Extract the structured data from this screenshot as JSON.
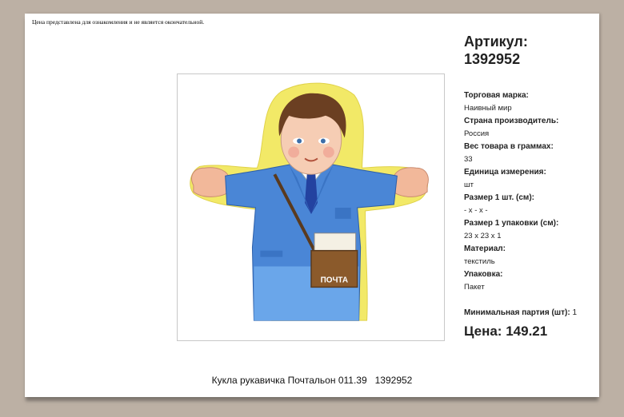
{
  "disclaimer": "Цена представлена для ознакомления и не является окончательной.",
  "article": {
    "label": "Артикул:",
    "number": "1392952"
  },
  "properties": [
    {
      "label": "Торговая марка:",
      "value": "Наивный мир"
    },
    {
      "label": "Страна производитель:",
      "value": "Россия"
    },
    {
      "label": "Вес товара в граммах:",
      "value": "33"
    },
    {
      "label": "Единица измерения:",
      "value": "шт"
    },
    {
      "label": "Размер 1 шт. (см):",
      "value": "- х - х -"
    },
    {
      "label": "Размер 1 упаковки (см):",
      "value": "23 х 23 х 1"
    },
    {
      "label": "Материал:",
      "value": "текстиль"
    },
    {
      "label": "Упаковка:",
      "value": "Пакет"
    }
  ],
  "min_order": {
    "label": "Минимальная партия (шт):",
    "value": "1"
  },
  "price": {
    "label": "Цена:",
    "value": "149.21"
  },
  "product": {
    "caption": "Кукла рукавичка Почтальон 011.39   1392952",
    "bag_text": "ПОЧТА"
  },
  "colors": {
    "background": "#bcb0a4",
    "puppet_fabric": "#f2e967",
    "uniform": "#4a86d6",
    "bag": "#8b5a2b"
  }
}
